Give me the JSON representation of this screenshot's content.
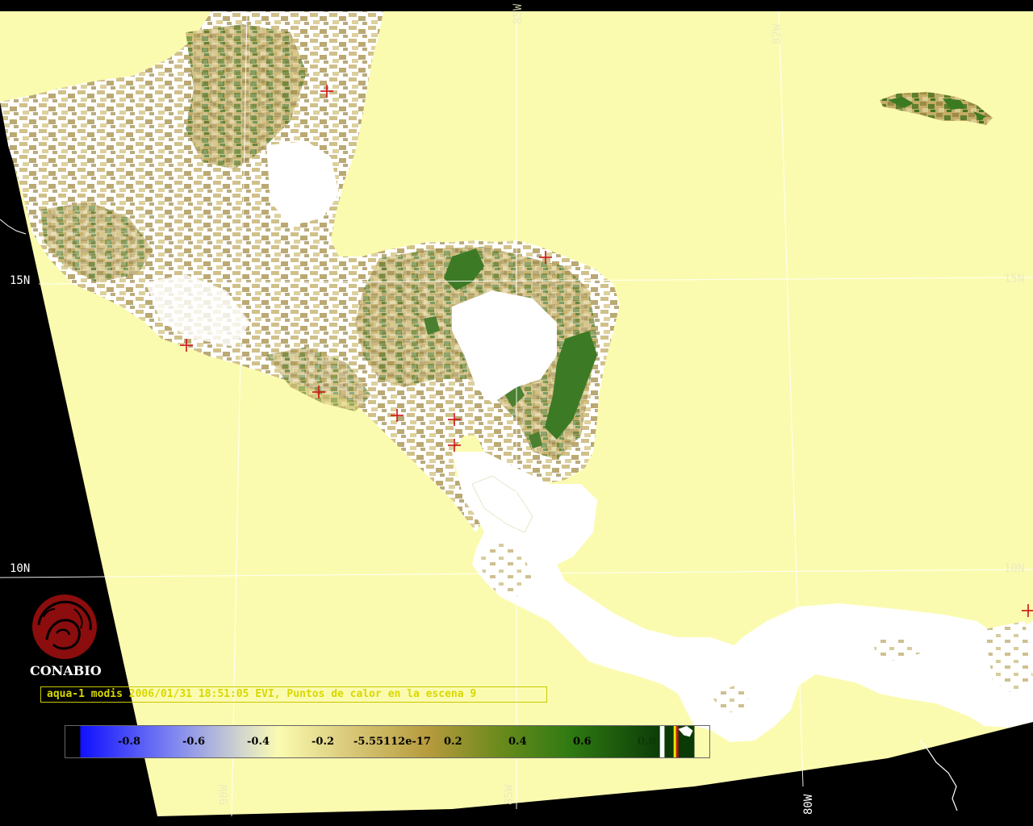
{
  "map": {
    "grid_labels": {
      "lat_15_left": "15N",
      "lat_15_right": "15N",
      "lat_10_left": "10N",
      "lat_10_right": "10N",
      "lon_85_top": "85W",
      "lon_82_top": "82W",
      "lon_90_bottom": "90W",
      "lon_85_bottom": "85W",
      "lon_80_bottom": "80W"
    },
    "hotspot_count": 9,
    "colors": {
      "background": "#000000",
      "ocean": "#fbfbb0",
      "land_cloud": "#ffffff",
      "vegetation_low": "#b9a45b",
      "vegetation_high": "#2f7a22",
      "hotspot_marker": "#cc1111"
    }
  },
  "logo": {
    "text": "CONABIO",
    "color": "#8b0d0d"
  },
  "caption": {
    "text": "aqua-1 modis 2006/01/31 18:51:05 EVI, Puntos de calor en la escena 9"
  },
  "colorbar": {
    "ticks": [
      "-0.8",
      "-0.6",
      "-0.4",
      "-0.2",
      "-5.55112e-17",
      "0.2",
      "0.4",
      "0.6",
      "0.8"
    ]
  }
}
